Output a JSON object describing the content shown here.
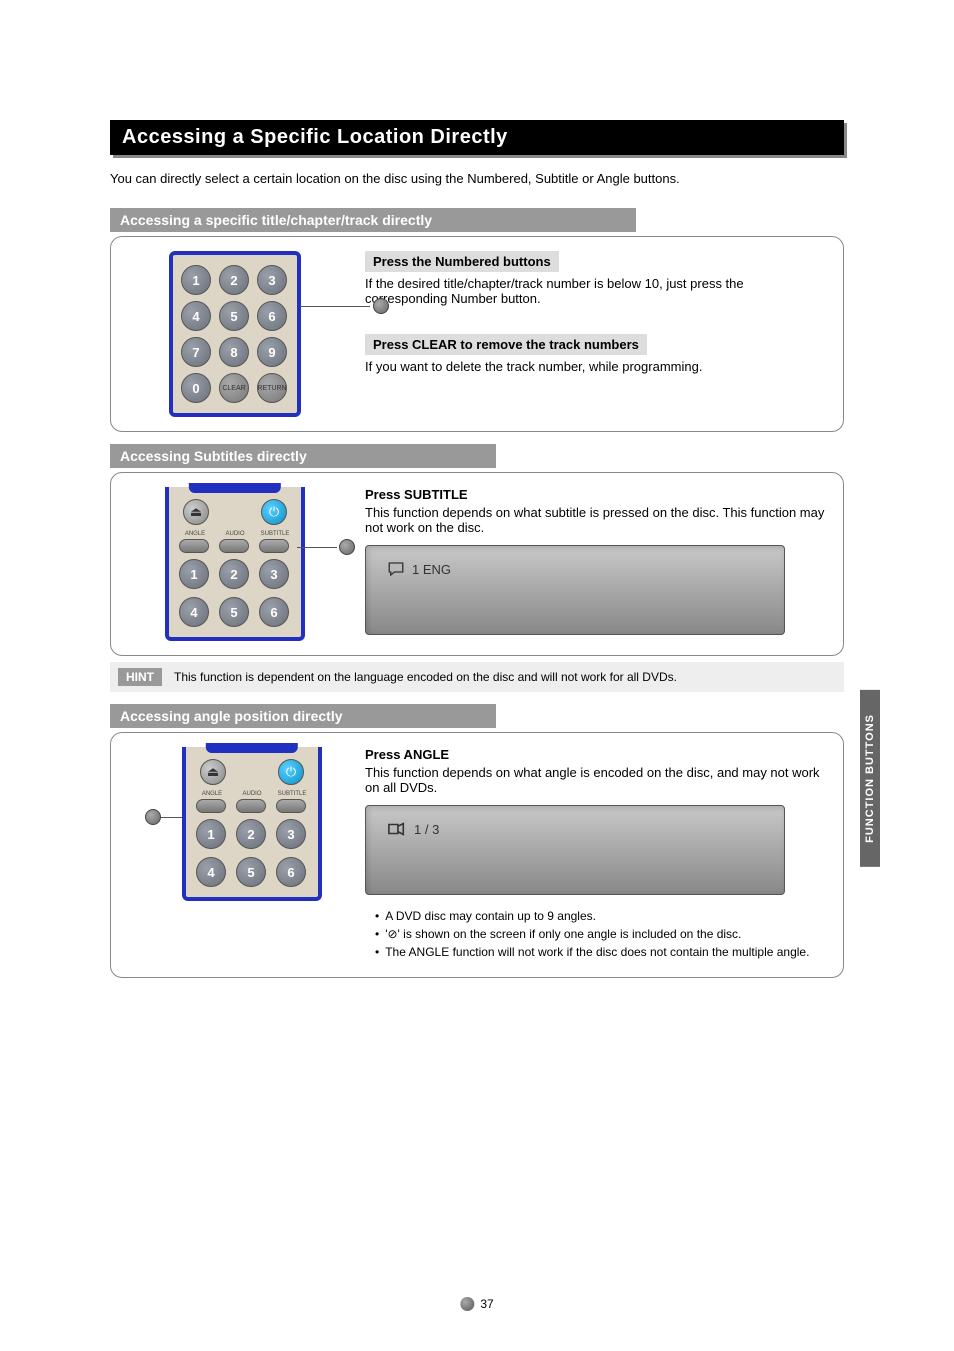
{
  "title": "Accessing a Specific Location Directly",
  "intro": "You can directly select a certain location on the disc using the Numbered, Subtitle or Angle buttons.",
  "sections": {
    "numbered": {
      "header": "Accessing a specific title/chapter/track directly",
      "step1_label": "Press the Numbered buttons",
      "step1_desc": "If the desired title/chapter/track number is below 10, just press the corresponding Number button.",
      "step2_label": "Press CLEAR to remove the track numbers",
      "step2_desc": "If you want to delete the track number, while programming."
    },
    "subtitle": {
      "header": "Accessing Subtitles directly",
      "step1_label": "Press SUBTITLE",
      "step1_desc": "This function depends on what subtitle is pressed on the disc. This function may not work on the disc.",
      "osd": "1   ENG",
      "hint_label": "HINT",
      "hints": [
        "This function is dependent on the language encoded on the disc and will not work for all DVDs."
      ]
    },
    "angle": {
      "header": "Accessing angle position directly",
      "step1_label": "Press ANGLE",
      "step1_desc": "This function depends on what angle is encoded on the disc, and may not work on all DVDs.",
      "osd": "1 / 3",
      "notes": [
        "A DVD disc may contain up to 9 angles.",
        "'⊘' is shown on the screen if only one angle is included on the disc.",
        "The ANGLE function will not work if the disc does not contain the multiple angle."
      ]
    }
  },
  "remote": {
    "numbers": [
      "1",
      "2",
      "3",
      "4",
      "5",
      "6",
      "7",
      "8",
      "9",
      "0"
    ],
    "clear": "CLEAR",
    "return": "RETURN",
    "labels": [
      "ANGLE",
      "AUDIO",
      "SUBTITLE"
    ]
  },
  "side_tab": "FUNCTION BUTTONS",
  "page_number": "37"
}
